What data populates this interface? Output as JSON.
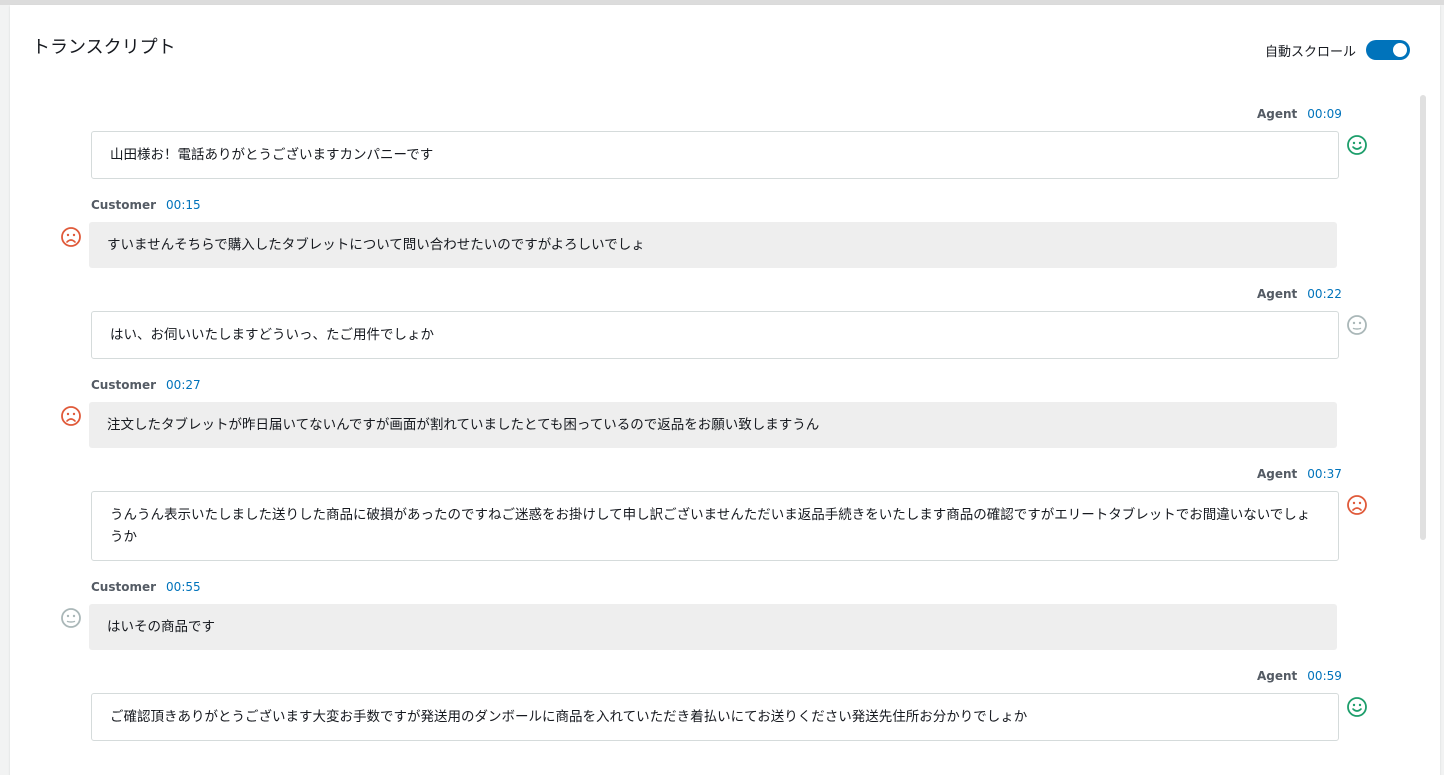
{
  "header": {
    "title": "トランスクリプト",
    "autoscroll_label": "自動スクロール",
    "autoscroll_on": true
  },
  "colors": {
    "accent": "#0073bb",
    "positive": "#1d9e6b",
    "negative": "#e05a3a",
    "neutral": "#aab7b8"
  },
  "messages": [
    {
      "speaker": "Agent",
      "time": "00:09",
      "text": "山田様お！電話ありがとうございますカンパニーです",
      "sentiment": "positive-smile-icon"
    },
    {
      "speaker": "Customer",
      "time": "00:15",
      "text": "すいませんそちらで購入したタブレットについて問い合わせたいのですがよろしいでしょ",
      "sentiment": "negative-frown-icon"
    },
    {
      "speaker": "Agent",
      "time": "00:22",
      "text": "はい、お伺いいたしますどういっ、たご用件でしょか",
      "sentiment": "neutral-face-icon"
    },
    {
      "speaker": "Customer",
      "time": "00:27",
      "text": "注文したタブレットが昨日届いてないんですが画面が割れていましたとても困っているので返品をお願い致しますうん",
      "sentiment": "negative-frown-icon"
    },
    {
      "speaker": "Agent",
      "time": "00:37",
      "text": "うんうん表示いたしました送りした商品に破損があったのですねご迷惑をお掛けして申し訳ございませんただいま返品手続きをいたします商品の確認ですがエリートタブレットでお間違いないでしょうか",
      "sentiment": "negative-frown-icon"
    },
    {
      "speaker": "Customer",
      "time": "00:55",
      "text": "はいその商品です",
      "sentiment": "neutral-face-icon"
    },
    {
      "speaker": "Agent",
      "time": "00:59",
      "text": "ご確認頂きありがとうございます大変お手数ですが発送用のダンボールに商品を入れていただき着払いにてお送りください発送先住所お分かりでしょか",
      "sentiment": "positive-smile-icon"
    }
  ]
}
